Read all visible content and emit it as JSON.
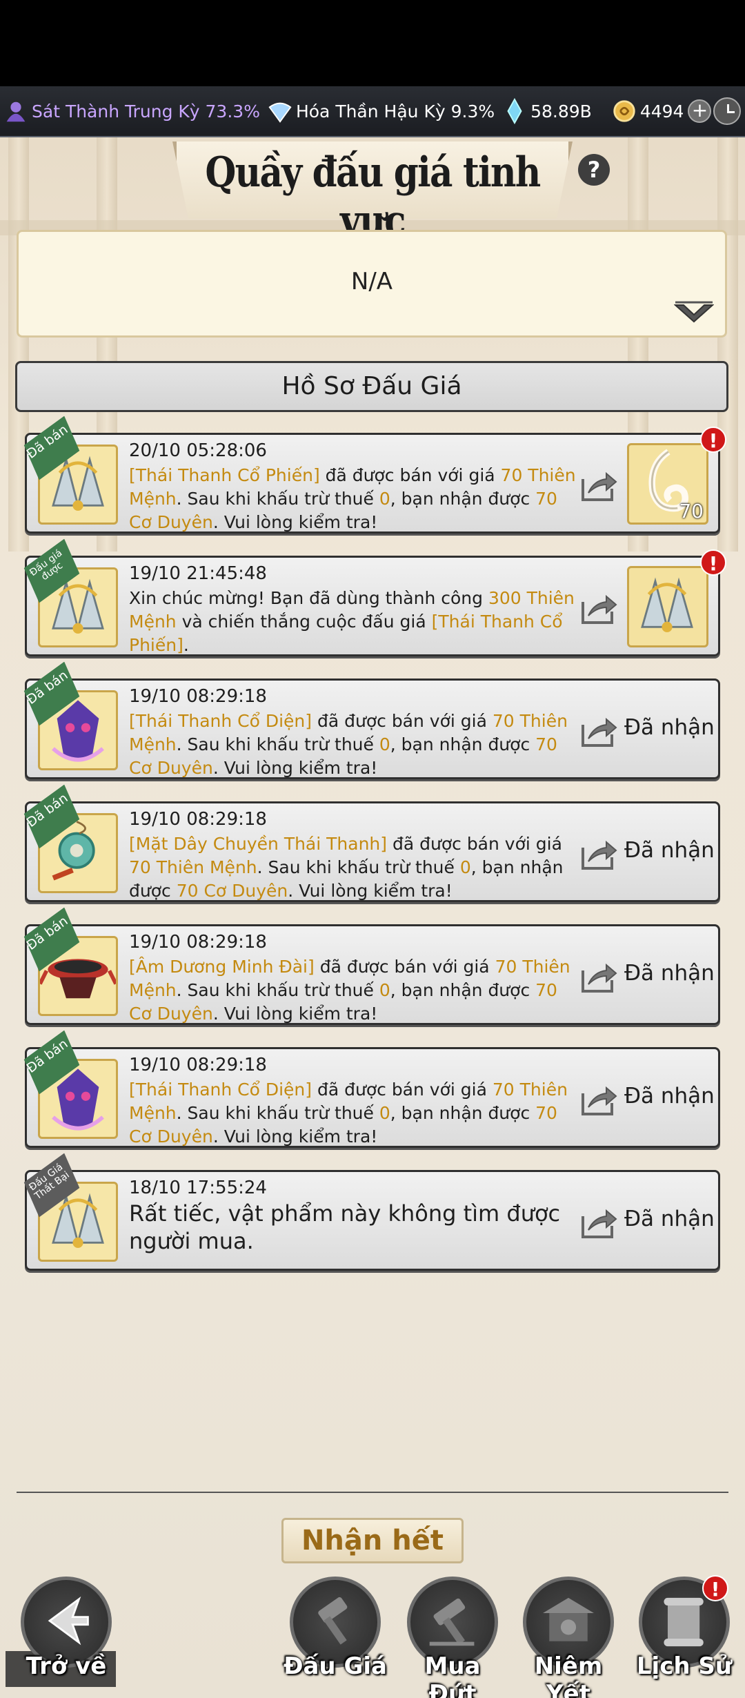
{
  "resources": [
    {
      "icon": "realm-icon",
      "label": "Sát Thành Trung Kỳ 73.3%",
      "color": "#c9a6ff"
    },
    {
      "icon": "fan-icon",
      "label": "Hóa Thần Hậu Kỳ 9.3%",
      "color": "#ffffff"
    },
    {
      "icon": "crystal-icon",
      "label": "58.89B",
      "color": "#ffffff"
    },
    {
      "icon": "coin-icon",
      "label": "4494",
      "color": "#ffffff"
    }
  ],
  "header": {
    "title": "Quầy đấu giá tinh vực",
    "help": "?"
  },
  "filter": {
    "value": "N/A"
  },
  "section": {
    "title": "Hồ Sơ Đấu Giá"
  },
  "records": [
    {
      "tag": "Đã bán",
      "time": "20/10  05:28:06",
      "parts": [
        {
          "t": "[Thái Thanh Cổ Phiến]",
          "gold": true
        },
        {
          "t": " đã được bán với giá "
        },
        {
          "t": "70 Thiên Mệnh",
          "gold": true
        },
        {
          "t": ". Sau khi khấu trừ thuế "
        },
        {
          "t": "0",
          "gold": true
        },
        {
          "t": ", bạn nhận được "
        },
        {
          "t": "70 Cơ Duyên",
          "gold": true
        },
        {
          "t": ". Vui lòng kiểm tra!"
        }
      ],
      "reward": {
        "type": "jade",
        "count": "70"
      },
      "alert": true
    },
    {
      "tag": "Đấu giá được",
      "time": "19/10  21:45:48",
      "parts": [
        {
          "t": "Xin chúc mừng! Bạn đã dùng thành công "
        },
        {
          "t": "300 Thiên Mệnh",
          "gold": true
        },
        {
          "t": " và chiến thắng cuộc đấu giá "
        },
        {
          "t": "[Thái Thanh Cổ Phiến]",
          "gold": true
        },
        {
          "t": "."
        }
      ],
      "reward": {
        "type": "fan",
        "count": ""
      },
      "alert": true
    },
    {
      "tag": "Đã bán",
      "time": "19/10  08:29:18",
      "parts": [
        {
          "t": "[Thái Thanh Cổ Diện]",
          "gold": true
        },
        {
          "t": " đã được bán với giá "
        },
        {
          "t": "70 Thiên Mệnh",
          "gold": true
        },
        {
          "t": ". Sau khi khấu trừ thuế "
        },
        {
          "t": "0",
          "gold": true
        },
        {
          "t": ", bạn nhận được "
        },
        {
          "t": "70 Cơ Duyên",
          "gold": true
        },
        {
          "t": ". Vui lòng kiểm tra!"
        }
      ],
      "status": "Đã nhận"
    },
    {
      "tag": "Đã bán",
      "time": "19/10  08:29:18",
      "parts": [
        {
          "t": "[Mặt Dây Chuyền Thái Thanh]",
          "gold": true
        },
        {
          "t": " đã được bán với giá "
        },
        {
          "t": "70 Thiên Mệnh",
          "gold": true
        },
        {
          "t": ". Sau khi khấu trừ thuế "
        },
        {
          "t": "0",
          "gold": true
        },
        {
          "t": ", bạn nhận được "
        },
        {
          "t": "70 Cơ Duyên",
          "gold": true
        },
        {
          "t": ". Vui lòng kiểm tra!"
        }
      ],
      "status": "Đã nhận"
    },
    {
      "tag": "Đã bán",
      "time": "19/10  08:29:18",
      "parts": [
        {
          "t": "[Âm Dương Minh Đài]",
          "gold": true
        },
        {
          "t": " đã được bán với giá "
        },
        {
          "t": "70 Thiên Mệnh",
          "gold": true
        },
        {
          "t": ". Sau khi khấu trừ thuế "
        },
        {
          "t": "0",
          "gold": true
        },
        {
          "t": ", bạn nhận được "
        },
        {
          "t": "70 Cơ Duyên",
          "gold": true
        },
        {
          "t": ". Vui lòng kiểm tra!"
        }
      ],
      "status": "Đã nhận"
    },
    {
      "tag": "Đã bán",
      "time": "19/10  08:29:18",
      "parts": [
        {
          "t": "[Thái Thanh Cổ Diện]",
          "gold": true
        },
        {
          "t": " đã được bán với giá "
        },
        {
          "t": "70 Thiên Mệnh",
          "gold": true
        },
        {
          "t": ". Sau khi khấu trừ thuế "
        },
        {
          "t": "0",
          "gold": true
        },
        {
          "t": ", bạn nhận được "
        },
        {
          "t": "70 Cơ Duyên",
          "gold": true
        },
        {
          "t": ". Vui lòng kiểm tra!"
        }
      ],
      "status": "Đã nhận"
    },
    {
      "tag": "Đấu Giá Thất Bại",
      "time": "18/10  17:55:24",
      "parts": [
        {
          "t": "Rất tiếc, vật phẩm này không tìm được người mua."
        }
      ],
      "big": true,
      "status": "Đã nhận"
    }
  ],
  "actions": {
    "claim_all": "Nhận hết"
  },
  "nav": [
    {
      "name": "back",
      "label": "Trở về"
    },
    {
      "name": "auction",
      "label": "Đấu Giá"
    },
    {
      "name": "buyout",
      "label": "Mua Đứt"
    },
    {
      "name": "listing",
      "label": "Niêm Yết"
    },
    {
      "name": "history",
      "label": "Lịch Sử"
    }
  ]
}
